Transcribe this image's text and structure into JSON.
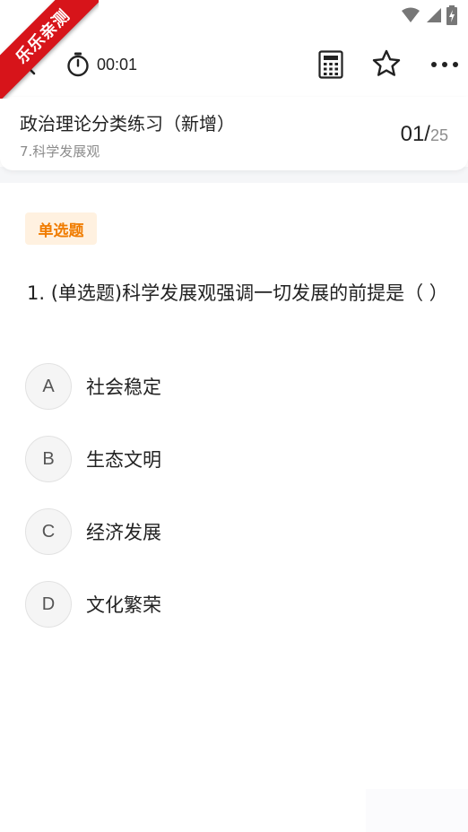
{
  "watermark": {
    "text": "乐乐亲测"
  },
  "status_bar": {
    "icons": [
      "wifi-icon",
      "signal-icon",
      "battery-charging-icon"
    ]
  },
  "nav": {
    "back_icon": "back-chevron-icon",
    "timer_icon": "stopwatch-icon",
    "timer_value": "00:01",
    "calculator_icon": "calculator-icon",
    "favorite_icon": "star-outline-icon",
    "more_icon": "more-dots-icon"
  },
  "header": {
    "title": "政治理论分类练习（新增）",
    "subtitle": "7.科学发展观",
    "current": "01/",
    "total": "25"
  },
  "question": {
    "type_badge": "单选题",
    "text": "1. (单选题)科学发展观强调一切发展的前提是（    ）",
    "options": [
      {
        "letter": "A",
        "text": "社会稳定"
      },
      {
        "letter": "B",
        "text": "生态文明"
      },
      {
        "letter": "C",
        "text": "经济发展"
      },
      {
        "letter": "D",
        "text": "文化繁荣"
      }
    ]
  }
}
